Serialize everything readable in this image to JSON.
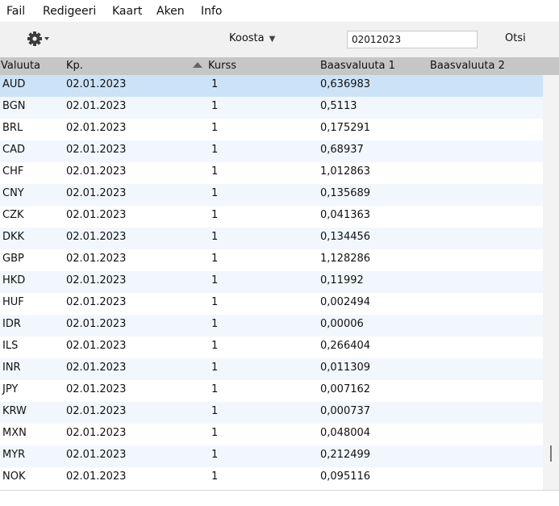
{
  "menu": [
    "Fail",
    "Redigeeri",
    "Kaart",
    "Aken",
    "Info"
  ],
  "toolbar": {
    "koosta_label": "Koosta",
    "date_value": "02012023",
    "otsi_label": "Otsi"
  },
  "columns": [
    "Valuuta",
    "Kp.",
    "Kurss",
    "Baasvaluuta 1",
    "Baasvaluuta 2"
  ],
  "rows": [
    [
      "AUD",
      "02.01.2023",
      "1",
      "0,636983",
      ""
    ],
    [
      "BGN",
      "02.01.2023",
      "1",
      "0,5113",
      ""
    ],
    [
      "BRL",
      "02.01.2023",
      "1",
      "0,175291",
      ""
    ],
    [
      "CAD",
      "02.01.2023",
      "1",
      "0,68937",
      ""
    ],
    [
      "CHF",
      "02.01.2023",
      "1",
      "1,012863",
      ""
    ],
    [
      "CNY",
      "02.01.2023",
      "1",
      "0,135689",
      ""
    ],
    [
      "CZK",
      "02.01.2023",
      "1",
      "0,041363",
      ""
    ],
    [
      "DKK",
      "02.01.2023",
      "1",
      "0,134456",
      ""
    ],
    [
      "GBP",
      "02.01.2023",
      "1",
      "1,128286",
      ""
    ],
    [
      "HKD",
      "02.01.2023",
      "1",
      "0,11992",
      ""
    ],
    [
      "HUF",
      "02.01.2023",
      "1",
      "0,002494",
      ""
    ],
    [
      "IDR",
      "02.01.2023",
      "1",
      "0,00006",
      ""
    ],
    [
      "ILS",
      "02.01.2023",
      "1",
      "0,266404",
      ""
    ],
    [
      "INR",
      "02.01.2023",
      "1",
      "0,011309",
      ""
    ],
    [
      "JPY",
      "02.01.2023",
      "1",
      "0,007162",
      ""
    ],
    [
      "KRW",
      "02.01.2023",
      "1",
      "0,000737",
      ""
    ],
    [
      "MXN",
      "02.01.2023",
      "1",
      "0,048004",
      ""
    ],
    [
      "MYR",
      "02.01.2023",
      "1",
      "0,212499",
      ""
    ],
    [
      "NOK",
      "02.01.2023",
      "1",
      "0,095116",
      ""
    ]
  ],
  "icons": {
    "settings": "gear-icon",
    "sort": "sort-ascending-icon"
  },
  "colors": {
    "header_bg": "#c6c6c6",
    "selected_row": "#cce3f7",
    "alt_row": "#f2f7fd",
    "toolbar_bg": "#f1f1f1"
  }
}
